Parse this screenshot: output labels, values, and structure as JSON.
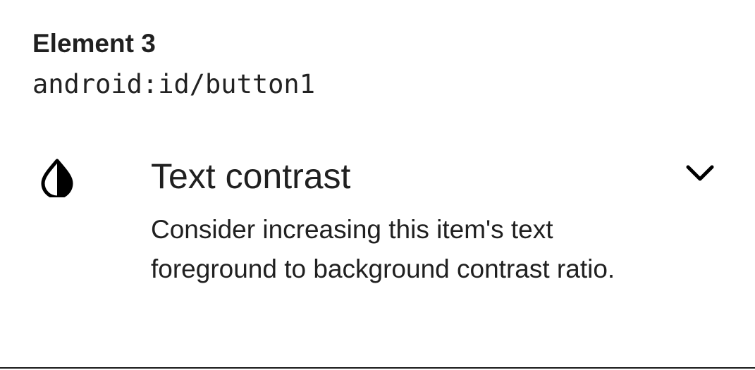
{
  "element": {
    "title": "Element 3",
    "resource_id": "android:id/button1"
  },
  "check": {
    "icon": "contrast-drop-icon",
    "title": "Text contrast",
    "description": "Consider increasing this item's text foreground to background contrast ratio.",
    "expand_icon": "chevron-down-icon"
  },
  "colors": {
    "text": "#202020",
    "background": "#ffffff"
  }
}
